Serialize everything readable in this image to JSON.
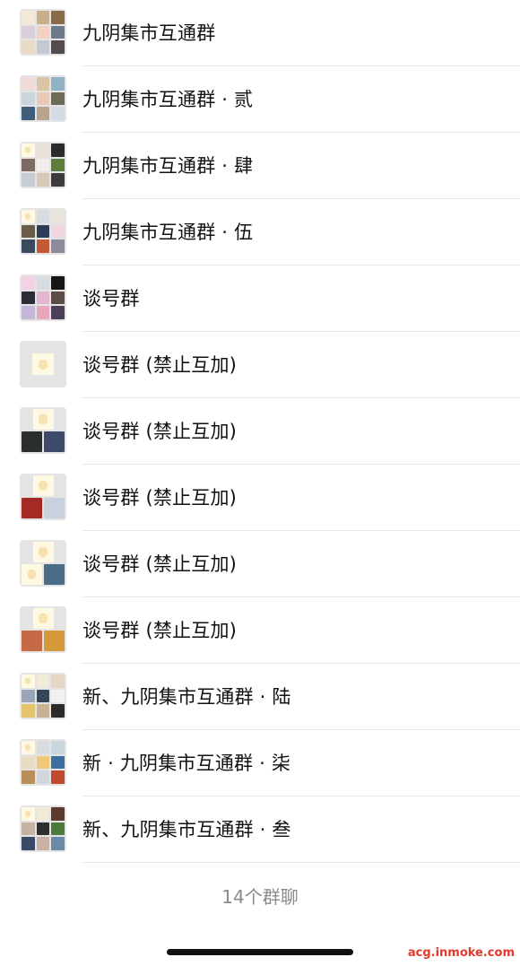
{
  "groups": [
    {
      "name": "九阴集市互通群",
      "avatar": {
        "layout": "g9",
        "tiles": [
          "#f4e9d6",
          "#c9b08a",
          "#8b6a4a",
          "#d7cfd9",
          "#f2d1c4",
          "#6d7a8a",
          "#e8dcc6",
          "#c4c8d3",
          "#544b4e"
        ]
      }
    },
    {
      "name": "九阴集市互通群 · 贰",
      "avatar": {
        "layout": "g9",
        "tiles": [
          "#f1dbd9",
          "#d9c4a7",
          "#8fb3c2",
          "#c9d6dd",
          "#e8c8b6",
          "#6d6a55",
          "#3f5c78",
          "#b7a48f",
          "#d4dbe4"
        ]
      }
    },
    {
      "name": "九阴集市互通群 · 肆",
      "avatar": {
        "layout": "g9",
        "tiles": [
          "#fff8e3",
          "#e7e1d6",
          "#2b2b2b",
          "#7f6a62",
          "#f0ecea",
          "#5f7e3b",
          "#c8ccd4",
          "#d9c9b8",
          "#3e3a3a"
        ]
      }
    },
    {
      "name": "九阴集市互通群 · 伍",
      "avatar": {
        "layout": "g9",
        "tiles": [
          "#fff8e3",
          "#d9dde2",
          "#e9e4d8",
          "#6a5b4b",
          "#2e3c57",
          "#f1d6e2",
          "#3b4a5c",
          "#c45a35",
          "#8e8a9b"
        ]
      }
    },
    {
      "name": "谈号群",
      "avatar": {
        "layout": "g9",
        "tiles": [
          "#f3d2e4",
          "#d8dde3",
          "#161616",
          "#2d2c39",
          "#e4b6d0",
          "#5b4c44",
          "#c5b7d7",
          "#e8a7bd",
          "#4a3f56"
        ]
      }
    },
    {
      "name": "谈号群 (禁止互加)",
      "avatar": {
        "layout": "g1",
        "tiles": [
          "#fff8e3"
        ]
      }
    },
    {
      "name": "谈号群 (禁止互加)",
      "avatar": {
        "layout": "g3",
        "tiles": [
          "#fff8e3",
          "#2a2f2e",
          "#3e4a6b"
        ]
      }
    },
    {
      "name": "谈号群 (禁止互加)",
      "avatar": {
        "layout": "g3",
        "tiles": [
          "#fff8e3",
          "#a42a25",
          "#c8d1de"
        ]
      }
    },
    {
      "name": "谈号群 (禁止互加)",
      "avatar": {
        "layout": "g3",
        "tiles": [
          "#fff8e3",
          "#fff8e3",
          "#4a6d8a"
        ]
      }
    },
    {
      "name": "谈号群 (禁止互加)",
      "avatar": {
        "layout": "g3",
        "tiles": [
          "#fff8e3",
          "#c66a45",
          "#d49a3a"
        ]
      }
    },
    {
      "name": "新、九阴集市互通群 · 陆",
      "avatar": {
        "layout": "g9",
        "tiles": [
          "#fff8e3",
          "#f1ead9",
          "#e6d7c4",
          "#9aa6b6",
          "#35455a",
          "#f2f2f2",
          "#e5c36a",
          "#c9b294",
          "#2e2a27"
        ]
      }
    },
    {
      "name": "新 · 九阴集市互通群 · 柒",
      "avatar": {
        "layout": "g9",
        "tiles": [
          "#fff8e3",
          "#d9dde2",
          "#c8d6e0",
          "#e8dcc2",
          "#f0c879",
          "#3b6f9e",
          "#b98e5a",
          "#d1d6dc",
          "#c0492e"
        ]
      }
    },
    {
      "name": "新、九阴集市互通群 · 叁",
      "avatar": {
        "layout": "g9",
        "tiles": [
          "#fff8e3",
          "#f1ead9",
          "#5a3b2e",
          "#c7b3a3",
          "#2e2e2e",
          "#4b7a3d",
          "#384a66",
          "#c9b1a4",
          "#6b8aa7"
        ]
      }
    }
  ],
  "footer": {
    "count_text": "14个群聊"
  },
  "watermark": {
    "text": "acg.inmoke.com"
  },
  "colors": {
    "divider": "#e9e9e9",
    "label": "#111111",
    "footer": "#8a8a8a",
    "watermark": "#e23a2c"
  }
}
